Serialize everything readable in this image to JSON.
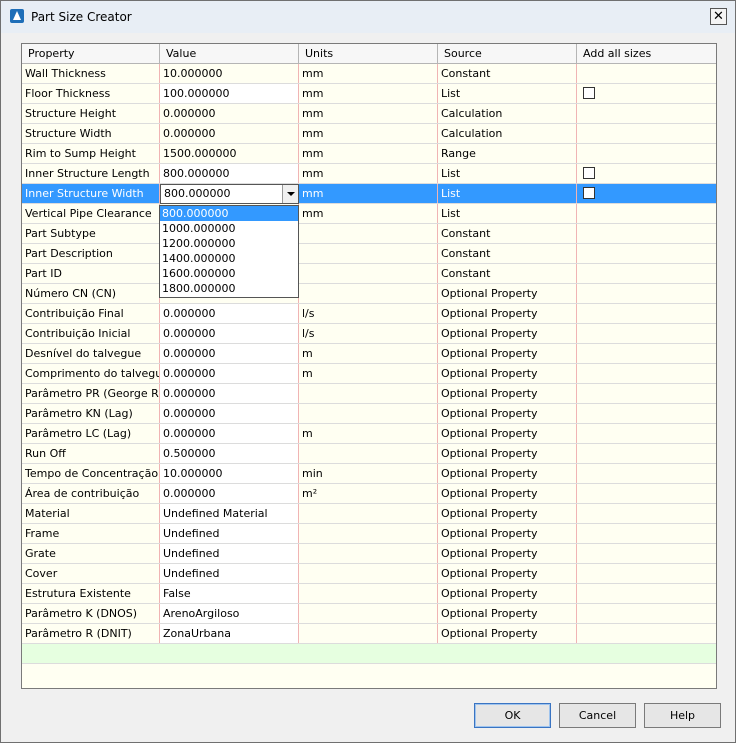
{
  "window": {
    "title": "Part Size Creator"
  },
  "columns": [
    "Property",
    "Value",
    "Units",
    "Source",
    "Add all sizes"
  ],
  "rows": [
    {
      "property": "Wall Thickness",
      "value": "10.000000",
      "units": "mm",
      "source": "Constant",
      "checkbox": false,
      "editable": false
    },
    {
      "property": "Floor Thickness",
      "value": "100.000000",
      "units": "mm",
      "source": "List",
      "checkbox": true,
      "editable": true
    },
    {
      "property": "Structure Height",
      "value": "0.000000",
      "units": "mm",
      "source": "Calculation",
      "checkbox": false,
      "editable": false
    },
    {
      "property": "Structure Width",
      "value": "0.000000",
      "units": "mm",
      "source": "Calculation",
      "checkbox": false,
      "editable": false
    },
    {
      "property": "Rim to Sump Height",
      "value": "1500.000000",
      "units": "mm",
      "source": "Range",
      "checkbox": false,
      "editable": false
    },
    {
      "property": "Inner Structure Length",
      "value": "800.000000",
      "units": "mm",
      "source": "List",
      "checkbox": true,
      "editable": true
    },
    {
      "property": "Inner Structure Width",
      "value": "800.000000",
      "units": "mm",
      "source": "List",
      "checkbox": true,
      "editable": true,
      "selected": true
    },
    {
      "property": "Vertical Pipe Clearance",
      "value": "",
      "units": "mm",
      "source": "List",
      "checkbox": false,
      "editable": false
    },
    {
      "property": "Part Subtype",
      "value": "",
      "units": "",
      "source": "Constant",
      "checkbox": false,
      "editable": false
    },
    {
      "property": "Part Description",
      "value": "",
      "units": "",
      "source": "Constant",
      "checkbox": false,
      "editable": false
    },
    {
      "property": "Part ID",
      "value": "",
      "units": "",
      "source": "Constant",
      "checkbox": false,
      "editable": false
    },
    {
      "property": "Número CN (CN)",
      "value": "",
      "units": "",
      "source": "Optional Property",
      "checkbox": false,
      "editable": false
    },
    {
      "property": "Contribuição Final",
      "value": "0.000000",
      "units": "l/s",
      "source": "Optional Property",
      "checkbox": false,
      "editable": true
    },
    {
      "property": "Contribuição Inicial",
      "value": "0.000000",
      "units": "l/s",
      "source": "Optional Property",
      "checkbox": false,
      "editable": true
    },
    {
      "property": "Desnível do talvegue",
      "value": "0.000000",
      "units": "m",
      "source": "Optional Property",
      "checkbox": false,
      "editable": true
    },
    {
      "property": "Comprimento do talvegue",
      "value": "0.000000",
      "units": "m",
      "source": "Optional Property",
      "checkbox": false,
      "editable": true
    },
    {
      "property": "Parâmetro PR (George Ribeiro)",
      "value": "0.000000",
      "units": "",
      "source": "Optional Property",
      "checkbox": false,
      "editable": true
    },
    {
      "property": "Parâmetro KN (Lag)",
      "value": "0.000000",
      "units": "",
      "source": "Optional Property",
      "checkbox": false,
      "editable": true
    },
    {
      "property": "Parâmetro LC (Lag)",
      "value": "0.000000",
      "units": "m",
      "source": "Optional Property",
      "checkbox": false,
      "editable": true
    },
    {
      "property": "Run Off",
      "value": "0.500000",
      "units": "",
      "source": "Optional Property",
      "checkbox": false,
      "editable": true
    },
    {
      "property": "Tempo de Concentração",
      "value": "10.000000",
      "units": "min",
      "source": "Optional Property",
      "checkbox": false,
      "editable": true
    },
    {
      "property": "Área de contribuição",
      "value": "0.000000",
      "units": "m²",
      "source": "Optional Property",
      "checkbox": false,
      "editable": true
    },
    {
      "property": "Material",
      "value": "Undefined Material",
      "units": "",
      "source": "Optional Property",
      "checkbox": false,
      "editable": true
    },
    {
      "property": "Frame",
      "value": "Undefined",
      "units": "",
      "source": "Optional Property",
      "checkbox": false,
      "editable": true
    },
    {
      "property": "Grate",
      "value": "Undefined",
      "units": "",
      "source": "Optional Property",
      "checkbox": false,
      "editable": true
    },
    {
      "property": "Cover",
      "value": "Undefined",
      "units": "",
      "source": "Optional Property",
      "checkbox": false,
      "editable": true
    },
    {
      "property": "Estrutura Existente",
      "value": "False",
      "units": "",
      "source": "Optional Property",
      "checkbox": false,
      "editable": true
    },
    {
      "property": "Parâmetro K (DNOS)",
      "value": "ArenoArgiloso",
      "units": "",
      "source": "Optional Property",
      "checkbox": false,
      "editable": true
    },
    {
      "property": "Parâmetro R (DNIT)",
      "value": "ZonaUrbana",
      "units": "",
      "source": "Optional Property",
      "checkbox": false,
      "editable": true
    }
  ],
  "dropdown": {
    "selected": "800.000000",
    "options": [
      "800.000000",
      "1000.000000",
      "1200.000000",
      "1400.000000",
      "1600.000000",
      "1800.000000"
    ]
  },
  "buttons": {
    "ok": "OK",
    "cancel": "Cancel",
    "help": "Help"
  }
}
